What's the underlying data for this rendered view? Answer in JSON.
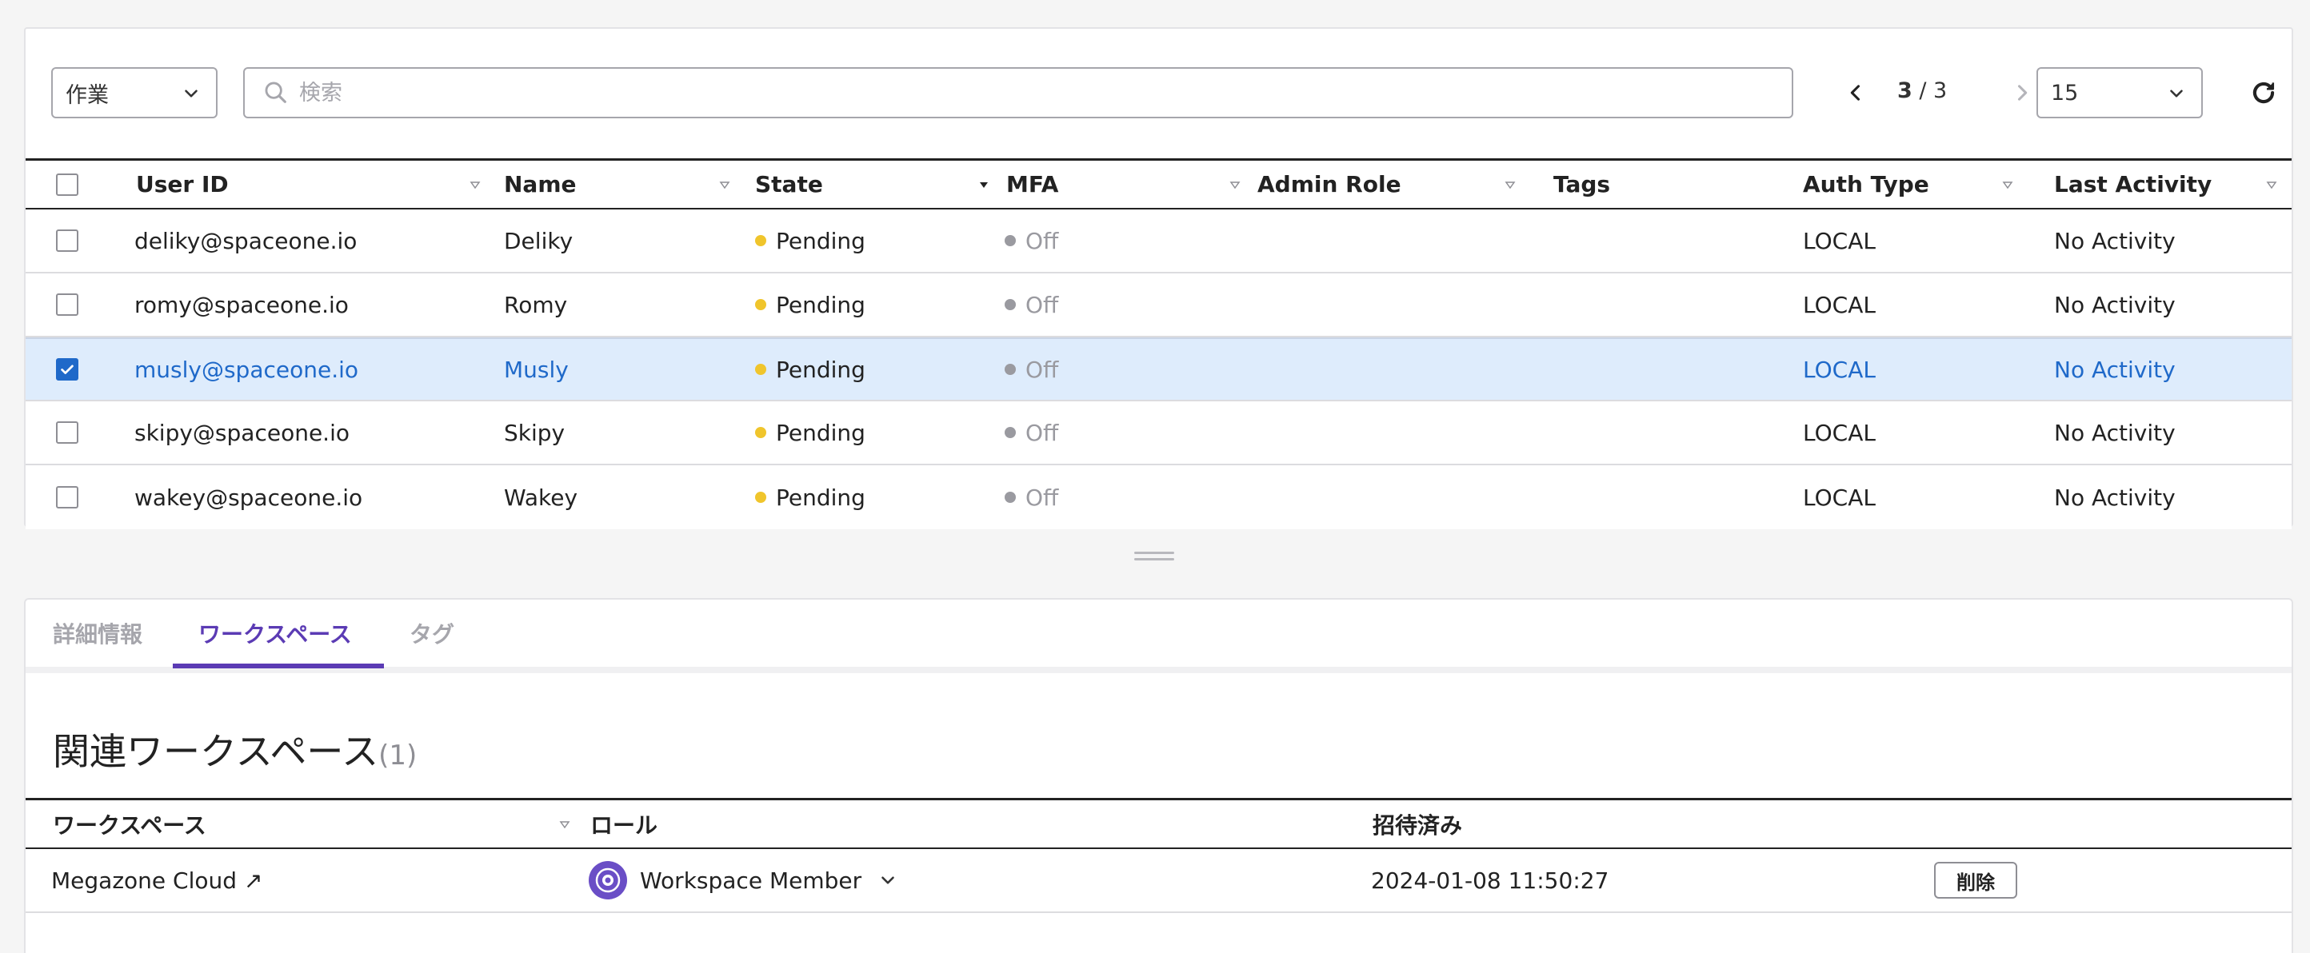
{
  "toolbar": {
    "action_label": "作業",
    "search_placeholder": "検索",
    "search_value": "",
    "page_current": "3",
    "page_sep_total": " / 3",
    "page_size": "15"
  },
  "table": {
    "columns": {
      "user_id": "User ID",
      "name": "Name",
      "state": "State",
      "mfa": "MFA",
      "admin_role": "Admin Role",
      "tags": "Tags",
      "auth_type": "Auth Type",
      "last_activity": "Last Activity"
    },
    "rows": [
      {
        "user_id": "deliky@spaceone.io",
        "name": "Deliky",
        "state": "Pending",
        "mfa": "Off",
        "admin_role": "",
        "tags": "",
        "auth_type": "LOCAL",
        "last_activity": "No Activity",
        "selected": false
      },
      {
        "user_id": "romy@spaceone.io",
        "name": "Romy",
        "state": "Pending",
        "mfa": "Off",
        "admin_role": "",
        "tags": "",
        "auth_type": "LOCAL",
        "last_activity": "No Activity",
        "selected": false
      },
      {
        "user_id": "musly@spaceone.io",
        "name": "Musly",
        "state": "Pending",
        "mfa": "Off",
        "admin_role": "",
        "tags": "",
        "auth_type": "LOCAL",
        "last_activity": "No Activity",
        "selected": true
      },
      {
        "user_id": "skipy@spaceone.io",
        "name": "Skipy",
        "state": "Pending",
        "mfa": "Off",
        "admin_role": "",
        "tags": "",
        "auth_type": "LOCAL",
        "last_activity": "No Activity",
        "selected": false
      },
      {
        "user_id": "wakey@spaceone.io",
        "name": "Wakey",
        "state": "Pending",
        "mfa": "Off",
        "admin_role": "",
        "tags": "",
        "auth_type": "LOCAL",
        "last_activity": "No Activity",
        "selected": false
      }
    ]
  },
  "detail": {
    "tabs": [
      {
        "label": "詳細情報",
        "active": false
      },
      {
        "label": "ワークスペース",
        "active": true
      },
      {
        "label": "タグ",
        "active": false
      }
    ],
    "section_title": "関連ワークスペース",
    "section_count": "(1)",
    "columns": {
      "workspace": "ワークスペース",
      "role": "ロール",
      "invited": "招待済み"
    },
    "rows": [
      {
        "workspace": "Megazone Cloud ↗",
        "role": "Workspace Member",
        "invited": "2024-01-08 11:50:27",
        "delete_label": "削除"
      }
    ]
  },
  "colors": {
    "accent": "#5b3bb4",
    "selected_row": "#deecfc",
    "link_blue": "#1f69c9",
    "pending": "#f0c52c",
    "off": "#9a9aa0"
  },
  "icons": {
    "action_chevron": "chevron-down-icon",
    "search": "search-icon",
    "prev_page": "chevron-left-icon",
    "next_page": "chevron-right-icon",
    "page_size_chevron": "chevron-down-icon",
    "refresh": "refresh-icon",
    "role": "workspace-member-icon"
  }
}
